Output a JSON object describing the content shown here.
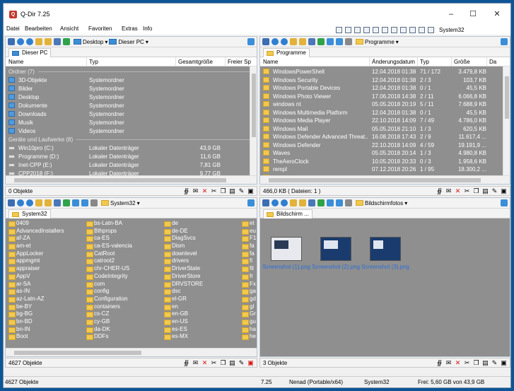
{
  "window": {
    "title": "Q-Dir 7.25",
    "app_icon": "Q"
  },
  "menu": [
    "Datei",
    "Bearbeiten",
    "Ansicht",
    "Favoriten",
    "Extras",
    "Info"
  ],
  "menu_right_label": "System32",
  "panes": {
    "top_left": {
      "toolbar_path": [
        "Desktop",
        "Dieser PC"
      ],
      "tab": "Dieser PC",
      "columns": [
        "Name",
        "Typ",
        "Gesamtgröße",
        "Freier Sp"
      ],
      "groups": [
        {
          "label": "Ordner (7)",
          "rows": [
            [
              "3D-Objekte",
              "Systemordner"
            ],
            [
              "Bilder",
              "Systemordner"
            ],
            [
              "Desktop",
              "Systemordner"
            ],
            [
              "Dokumente",
              "Systemordner"
            ],
            [
              "Downloads",
              "Systemordner"
            ],
            [
              "Musik",
              "Systemordner"
            ],
            [
              "Videos",
              "Systemordner"
            ]
          ]
        },
        {
          "label": "Geräte und Laufwerke (8)",
          "rows": [
            [
              "Win10pro (C:)",
              "Lokaler Datenträger",
              "43,9 GB"
            ],
            [
              "Programme (D:)",
              "Lokaler Datenträger",
              "11,6 GB"
            ],
            [
              "Inet-CPP (E:)",
              "Lokaler Datenträger",
              "7,81 GB"
            ],
            [
              "CPP2018 (F:)",
              "Lokaler Datenträger",
              "9,77 GB"
            ]
          ]
        }
      ],
      "status": "0 Objekte"
    },
    "top_right": {
      "toolbar_path": [
        "Programme"
      ],
      "tab": "Programme",
      "columns": [
        "Name",
        "Änderungsdatum",
        "Typ",
        "Größe",
        "Da"
      ],
      "rows": [
        [
          "WindowsPowerShell",
          "12.04.2018 01:38",
          "71 / 172",
          "3.479,8 KB"
        ],
        [
          "Windows Security",
          "12.04.2018 01:38",
          "2 / 3",
          "103,7 KB"
        ],
        [
          "Windows Portable Devices",
          "12.04.2018 01:38",
          "0 / 1",
          "45,5 KB"
        ],
        [
          "Windows Photo Viewer",
          "17.06.2018 14:38",
          "2 / 11",
          "6.066,8 KB"
        ],
        [
          "windows nt",
          "05.05.2018 20:19",
          "5 / 11",
          "7.688,9 KB"
        ],
        [
          "Windows Multimedia Platform",
          "12.04.2018 01:38",
          "0 / 1",
          "45,5 KB"
        ],
        [
          "Windows Media Player",
          "22.10.2018 14:09",
          "7 / 49",
          "4.786,0 KB"
        ],
        [
          "Windows Mail",
          "05.05.2018 21:10",
          "1 / 3",
          "620,5 KB"
        ],
        [
          "Windows Defender Advanced Threat...",
          "16.08.2018 17:43",
          "2 / 9",
          "11.617,4 ..."
        ],
        [
          "Windows Defender",
          "22.10.2018 14:09",
          "4 / 59",
          "19.191,9 ..."
        ],
        [
          "Waves",
          "05.05.2018 20:14",
          "1 / 3",
          "4.980,8 KB"
        ],
        [
          "TheAeroClock",
          "10.05.2018 20:33",
          "0 / 3",
          "1.958,6 KB"
        ],
        [
          "rempl",
          "07.12.2018 20:26",
          "1 / 95",
          "18.300,2 ..."
        ],
        [
          "Reference Assemblies",
          "05.05.2018 21:06",
          "19 / 110",
          "42.769,8 ..."
        ]
      ],
      "status": "466,0 KB ( Dateien: 1 )"
    },
    "bottom_left": {
      "toolbar_path": [
        "System32"
      ],
      "tab": "System32",
      "columns_items": [
        [
          "0409",
          "AdvancedInstallers",
          "af-ZA",
          "am-et",
          "AppLocker",
          "appmgmt",
          "appraiser",
          "AppV",
          "ar-SA",
          "as-IN",
          "az-Latn-AZ",
          "be-BY",
          "bg-BG",
          "bn-BD",
          "bn-IN",
          "Boot"
        ],
        [
          "bs-Latn-BA",
          "Bthprops",
          "ca-ES",
          "ca-ES-valencia",
          "CatRoot",
          "catroot2",
          "chr-CHER-US",
          "CodeIntegrity",
          "com",
          "config",
          "Configuration",
          "containers",
          "cs-CZ",
          "cy-GB",
          "da-DK",
          "DDFs"
        ],
        [
          "de",
          "de-DE",
          "DiagSvcs",
          "Dism",
          "downlevel",
          "drivers",
          "DriverState",
          "DriverStore",
          "DRVSTORE",
          "dsc",
          "el-GR",
          "en",
          "en-GB",
          "en-US",
          "es-ES",
          "es-MX"
        ],
        [
          "et",
          "eu",
          "F1",
          "fa",
          "fa",
          "fi",
          "fil",
          "fr",
          "Fx",
          "ga",
          "gd",
          "gl",
          "Gr",
          "gu",
          "ha",
          "he"
        ]
      ],
      "status": "4627 Objekte"
    },
    "bottom_right": {
      "toolbar_path": [
        "Bildschirmfotos"
      ],
      "tab": "Bildschirm ...",
      "thumbnails": [
        "Screenshot (1).png",
        "Screenshot (2).png",
        "Screenshot (3).png"
      ],
      "status": "3 Objekte"
    }
  },
  "statusbar": {
    "left": "4627 Objekte",
    "version": "7.25",
    "user": "Nenad (Portable/x64)",
    "folder": "System32",
    "free": "Frei: 5,60 GB von 43,9 GB"
  }
}
